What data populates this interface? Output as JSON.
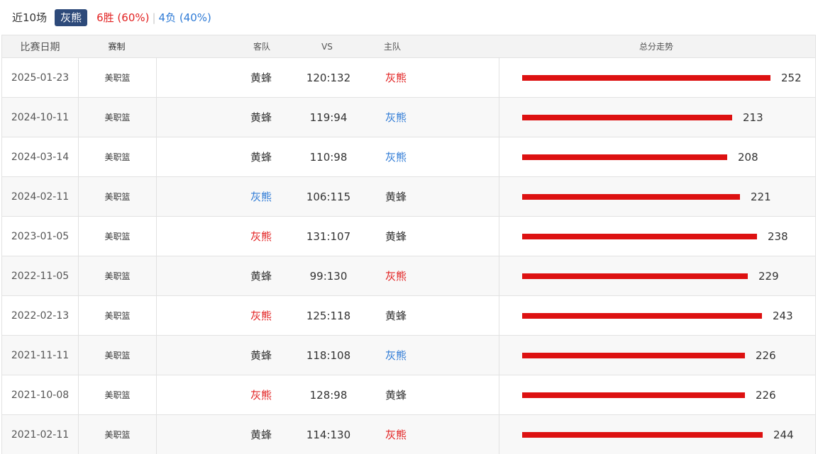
{
  "summary": {
    "title": "近10场",
    "team": "灰熊",
    "wins": "6胜 (60%)",
    "separator": "|",
    "losses": "4负 (40%)"
  },
  "headers": {
    "date": "比赛日期",
    "competition": "赛制",
    "away": "客队",
    "vs": "VS",
    "home": "主队",
    "trend": "总分走势"
  },
  "colors": {
    "bar": "#dd1111",
    "win_red": "#e22222",
    "loss_blue": "#2f7bd6",
    "badge_bg": "#2d4a7a"
  },
  "rows": [
    {
      "date": "2025-01-23",
      "competition": "美职篮",
      "away": "黄蜂",
      "score": "120:132",
      "home": "灰熊",
      "total": 252
    },
    {
      "date": "2024-10-11",
      "competition": "美职篮",
      "away": "黄蜂",
      "score": "119:94",
      "home": "灰熊",
      "total": 213
    },
    {
      "date": "2024-03-14",
      "competition": "美职篮",
      "away": "黄蜂",
      "score": "110:98",
      "home": "灰熊",
      "total": 208
    },
    {
      "date": "2024-02-11",
      "competition": "美职篮",
      "away": "灰熊",
      "score": "106:115",
      "home": "黄蜂",
      "total": 221
    },
    {
      "date": "2023-01-05",
      "competition": "美职篮",
      "away": "灰熊",
      "score": "131:107",
      "home": "黄蜂",
      "total": 238
    },
    {
      "date": "2022-11-05",
      "competition": "美职篮",
      "away": "黄蜂",
      "score": "99:130",
      "home": "灰熊",
      "total": 229
    },
    {
      "date": "2022-02-13",
      "competition": "美职篮",
      "away": "灰熊",
      "score": "125:118",
      "home": "黄蜂",
      "total": 243
    },
    {
      "date": "2021-11-11",
      "competition": "美职篮",
      "away": "黄蜂",
      "score": "118:108",
      "home": "灰熊",
      "total": 226
    },
    {
      "date": "2021-10-08",
      "competition": "美职篮",
      "away": "灰熊",
      "score": "128:98",
      "home": "黄蜂",
      "total": 226
    },
    {
      "date": "2021-02-11",
      "competition": "美职篮",
      "away": "黄蜂",
      "score": "114:130",
      "home": "灰熊",
      "total": 244
    }
  ]
}
